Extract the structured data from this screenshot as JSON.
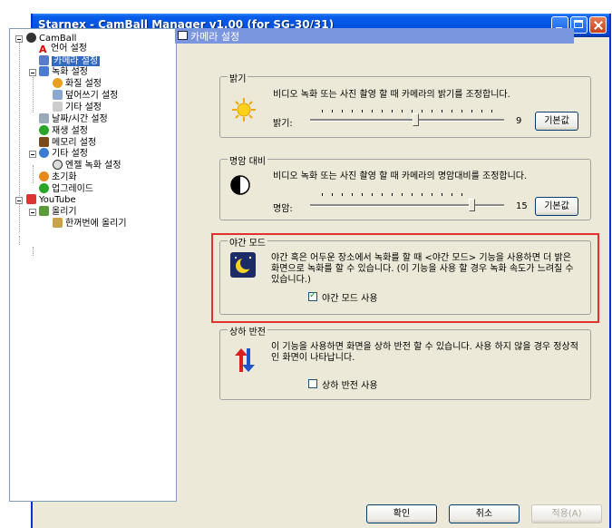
{
  "window": {
    "title": "Starnex - CamBall Manager v1.00 (for SG-30/31)"
  },
  "tree": {
    "items": [
      {
        "label": "CamBall",
        "icon": "camball-icon"
      },
      {
        "label": "언어 설정",
        "icon": "language-icon"
      },
      {
        "label": "카메라 설정",
        "icon": "camera-icon",
        "selected": true
      },
      {
        "label": "녹화 설정",
        "icon": "record-icon"
      },
      {
        "label": "화질 설정",
        "icon": "quality-icon"
      },
      {
        "label": "덮어쓰기 설정",
        "icon": "overwrite-icon"
      },
      {
        "label": "기타 설정",
        "icon": "misc-icon"
      },
      {
        "label": "날짜/시간 설정",
        "icon": "clock-icon"
      },
      {
        "label": "재생 설정",
        "icon": "play-icon"
      },
      {
        "label": "메모리 설정",
        "icon": "memory-icon"
      },
      {
        "label": "기타 설정",
        "icon": "settings-icon"
      },
      {
        "label": "엔젤 녹화 설정",
        "icon": "angel-icon"
      },
      {
        "label": "초기화",
        "icon": "reset-icon"
      },
      {
        "label": "업그레이드",
        "icon": "upgrade-icon"
      },
      {
        "label": "YouTube",
        "icon": "youtube-icon"
      },
      {
        "label": "올리기",
        "icon": "upload-icon"
      },
      {
        "label": "한꺼번에 올리기",
        "icon": "batch-upload-icon"
      }
    ]
  },
  "panel": {
    "title": "카메라 설정"
  },
  "brightness": {
    "title": "밝기",
    "desc": "비디오 녹화 또는 사진 촬영 할 때 카메라의 밝기를 조정합니다.",
    "label": "밝기:",
    "value": "9",
    "level": 0.6,
    "default_btn": "기본값"
  },
  "contrast": {
    "title": "명암 대비",
    "desc": "비디오 녹화 또는 사진 촬영 할 때 카메라의 명암대비를 조정합니다.",
    "label": "명암:",
    "value": "15",
    "level": 1.0,
    "default_btn": "기본값"
  },
  "night": {
    "title": "야간 모드",
    "desc": "야간 혹은 어두운 장소에서 녹화를 할 때 <야간 모드> 기능을 사용하면 더 밝은 화면으로 녹화를 할 수 있습니다. (이 기능을 사용 할 경우 녹화 속도가 느려질 수 있습니다.)",
    "checkbox": "야간 모드 사용",
    "checked": true
  },
  "flip": {
    "title": "상하 반전",
    "desc": "이 기능을 사용하면 화면을 상하 반전 할 수 있습니다. 사용 하지 않을 경우 정상적인 화면이 나타납니다.",
    "checkbox": "상하 반전 사용",
    "checked": false
  },
  "buttons": {
    "ok": "확인",
    "cancel": "취소",
    "apply": "적용(A)"
  }
}
